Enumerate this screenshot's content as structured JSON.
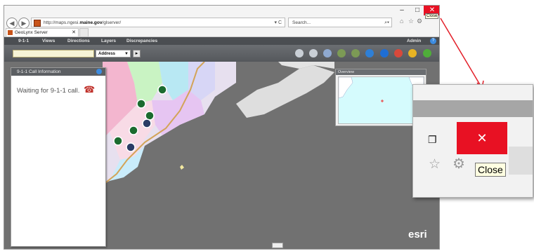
{
  "browser": {
    "address_url_prefix": "http://maps.ngesi.",
    "address_host": "maine.gov",
    "address_path": "/glserver/",
    "address_controls": "▾ C",
    "search_placeholder": "Search...",
    "tab_title": "GeoLynx Server",
    "tooltip": "Close",
    "window_controls": {
      "minimize": "–",
      "maximize": "□",
      "close": "✕"
    }
  },
  "app": {
    "menu": [
      "9-1-1",
      "Views",
      "Directions",
      "Layers",
      "Discrepancies"
    ],
    "user": "Admin",
    "search_value": "",
    "search_type": "Address"
  },
  "panel": {
    "title": "9-1-1 Call Information",
    "message": "Waiting for 9-1-1 call."
  },
  "overview": {
    "title": "Overview"
  },
  "branding": {
    "esri": "esri"
  },
  "zoom_callout": {
    "close_glyph": "✕",
    "tooltip": "Close"
  },
  "colors": {
    "close_red": "#e81123",
    "menu_bg": "#4b4e52",
    "map_bg": "#717171",
    "callout_arrow": "#e3202a"
  },
  "icons": [
    "back-icon",
    "forward-icon",
    "site-icon",
    "search-icon",
    "home-icon",
    "star-icon",
    "gear-icon",
    "phone-icon",
    "help-icon"
  ]
}
